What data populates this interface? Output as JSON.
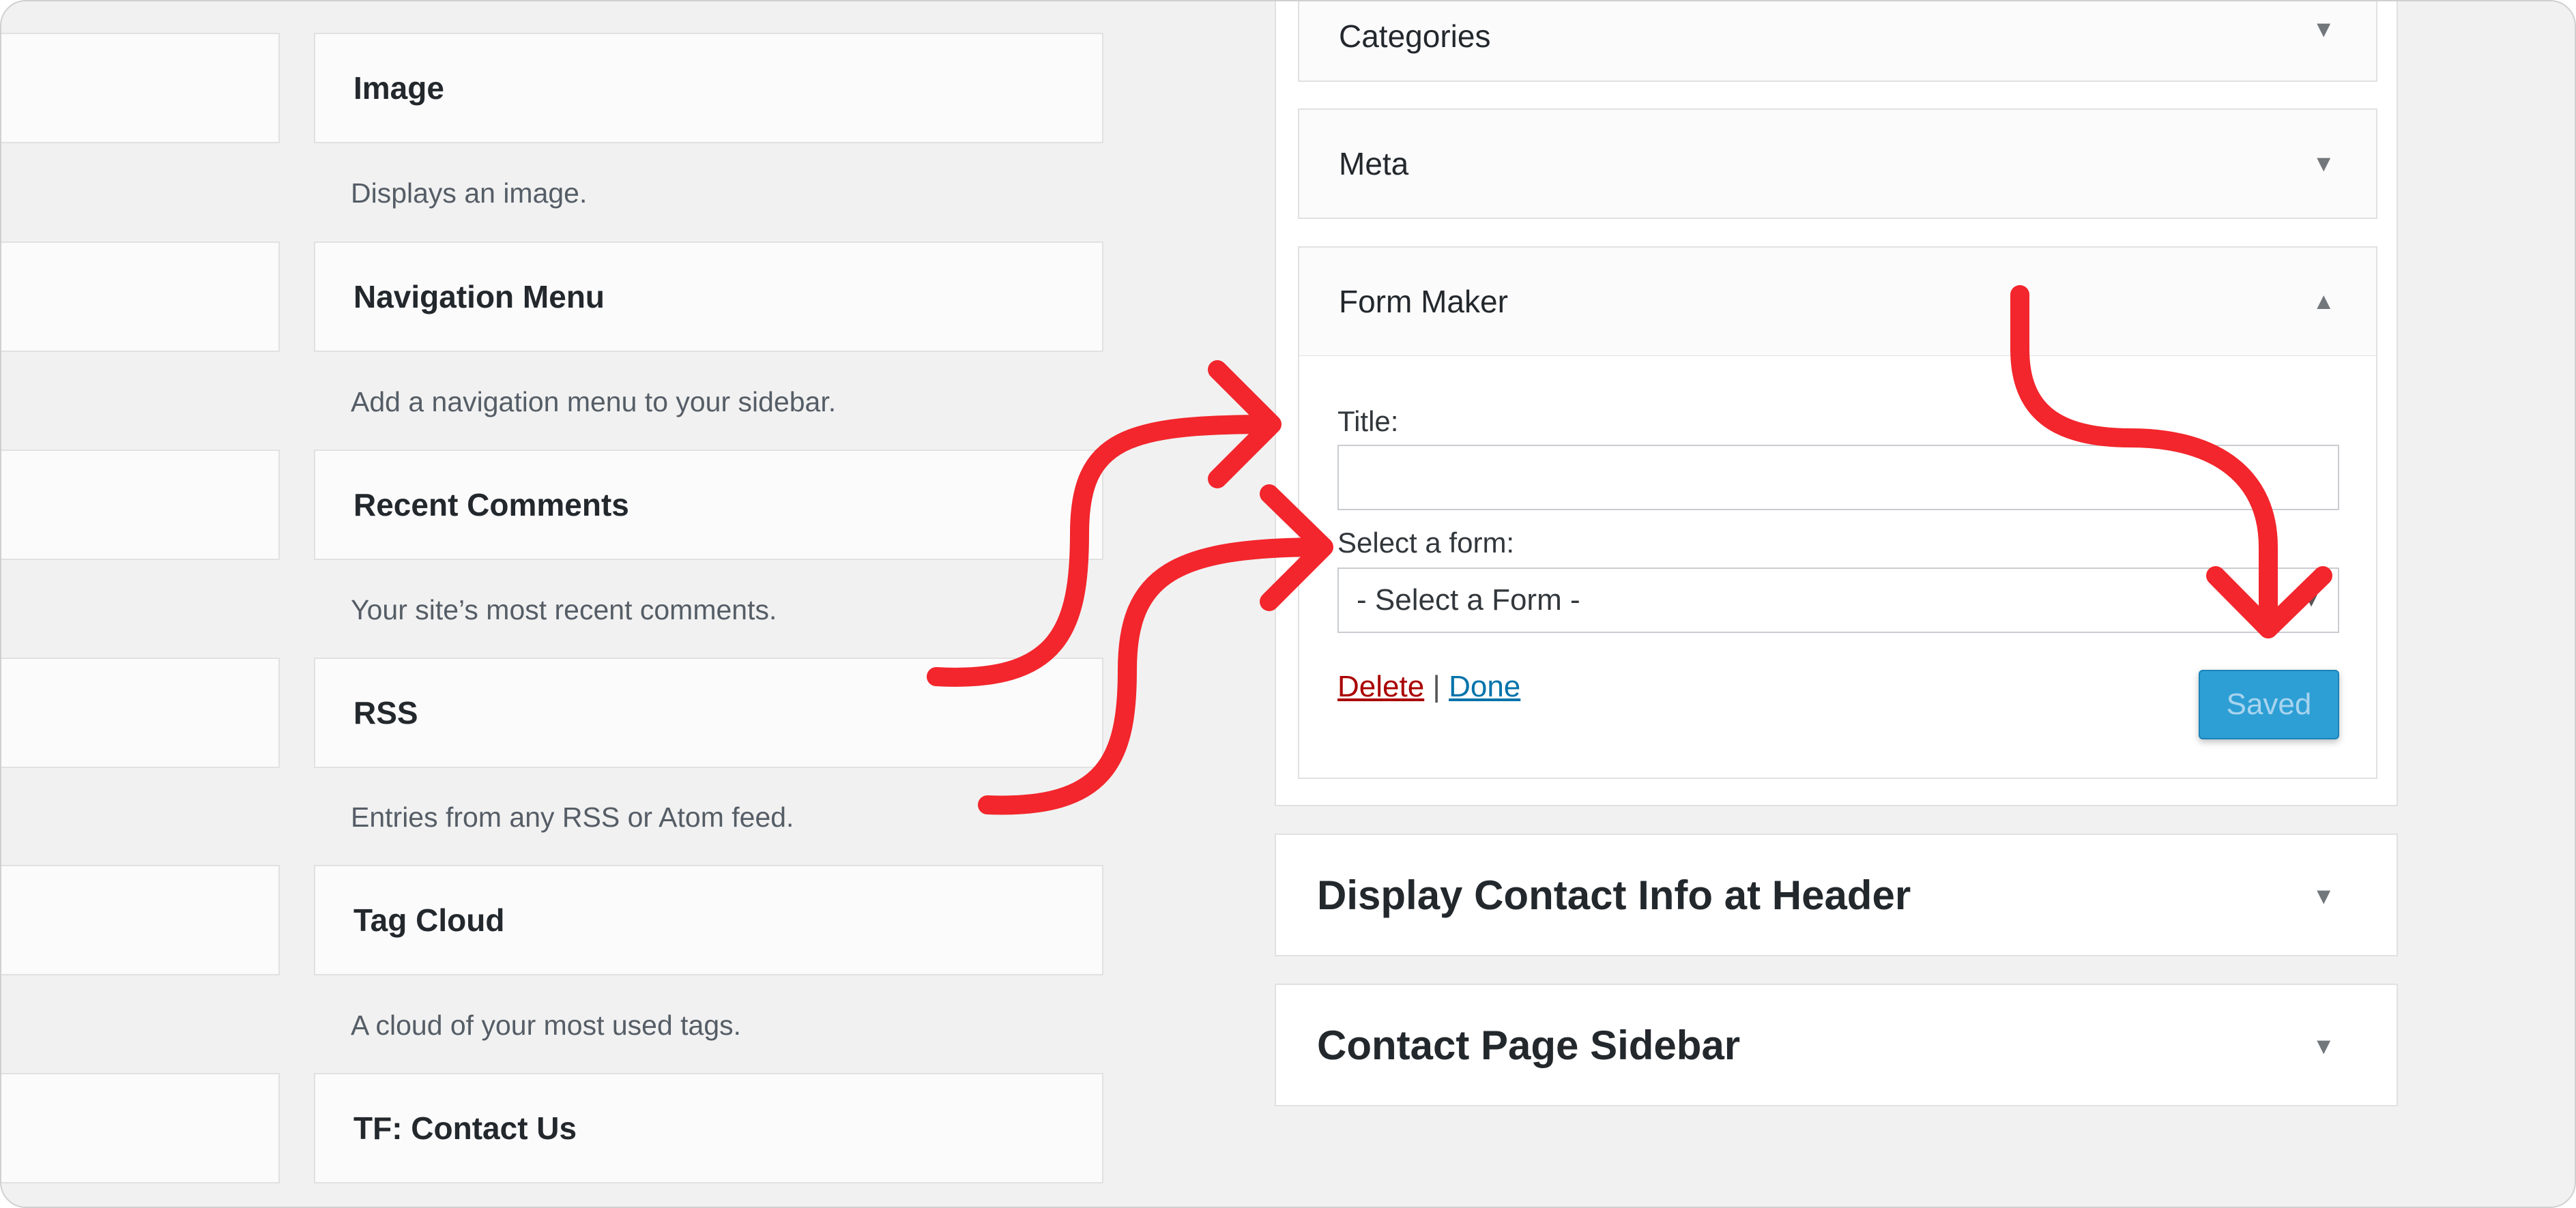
{
  "available_widgets": {
    "top_cut_text": "",
    "items": [
      {
        "title": "Image",
        "description": "Displays an image."
      },
      {
        "title": "Navigation Menu",
        "description": "Add a navigation menu to your sidebar."
      },
      {
        "title": "Recent Comments",
        "description": "Your site’s most recent comments."
      },
      {
        "title": "RSS",
        "description": "Entries from any RSS or Atom feed."
      },
      {
        "title": "Tag Cloud",
        "description": "A cloud of your most used tags."
      },
      {
        "title": "TF: Contact Us",
        "description": ""
      }
    ]
  },
  "sidebar": {
    "widgets": [
      {
        "title": "Categories"
      },
      {
        "title": "Meta"
      },
      {
        "title": "Form Maker"
      }
    ],
    "form_maker": {
      "title_label": "Title:",
      "title_value": "",
      "select_label": "Select a form:",
      "select_value": "- Select a Form -",
      "delete_label": "Delete",
      "separator": "|",
      "done_label": "Done",
      "saved_label": "Saved"
    }
  },
  "areas": [
    {
      "title": "Display Contact Info at Header"
    },
    {
      "title": "Contact Page Sidebar"
    }
  ],
  "colors": {
    "annotation_arrow": "#f2262c",
    "saved_button": "#2e9fd5",
    "delete_link": "#aa0000",
    "done_link": "#0073aa"
  },
  "icons": {
    "collapsed": "triangle-down-icon",
    "expanded": "triangle-up-icon"
  }
}
